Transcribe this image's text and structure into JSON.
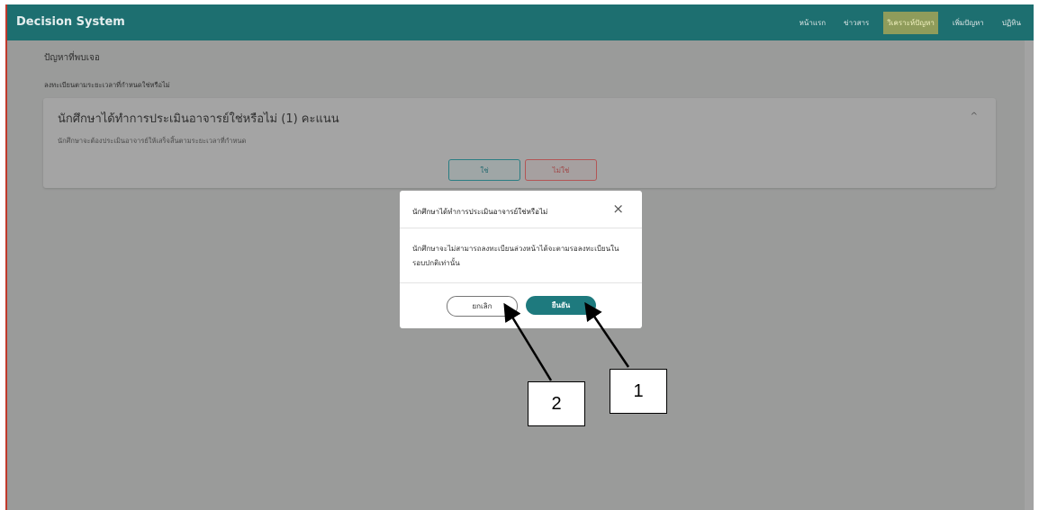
{
  "app": {
    "title": "Decision System"
  },
  "nav": {
    "items": [
      "หน้าแรก",
      "ข่าวสาร",
      "วิเคราะห์ปัญหา",
      "เพิ่มปัญหา",
      "ปฏิทิน"
    ],
    "active": "วิเคราะห์ปัญหา"
  },
  "page": {
    "section_title": "ปัญหาที่พบเจอ",
    "subtitle": "ลงทะเบียนตามระยะเวลาที่กำหนดใช่หรือไม่"
  },
  "question_card": {
    "title": "นักศึกษาได้ทำการประเมินอาจารย์ใช่หรือไม่ (1) คะแนน",
    "description": "นักศึกษาจะต้องประเมินอาจารย์ให้เสร็จสิ้นตามระยะเวลาที่กำหนด",
    "yes_label": "ใช่",
    "no_label": "ไม่ใช่"
  },
  "modal": {
    "title": "นักศึกษาได้ทำการประเมินอาจารย์ใช่หรือไม่",
    "body": "นักศึกษาจะไม่สามารถลงทะเบียนล่วงหน้าได้จะตามรอลงทะเบียนในรอบปกติเท่านั้น",
    "cancel_label": "ยกเลิก",
    "confirm_label": "ยืนยัน"
  },
  "annotations": [
    {
      "label": "1",
      "target": "confirm_button"
    },
    {
      "label": "2",
      "target": "cancel_button"
    }
  ],
  "colors": {
    "navbar": "#1d6f70",
    "nav_active": "#8f9c5b",
    "overlay": "#9a9b9a",
    "confirm_button": "#1e7a7e",
    "frame_border": "#c0392b"
  }
}
